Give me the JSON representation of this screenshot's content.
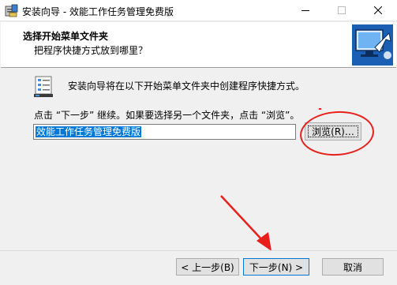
{
  "window": {
    "title": "安装向导 - 效能工作任务管理免费版"
  },
  "header": {
    "title": "选择开始菜单文件夹",
    "subtitle": "把程序快捷方式放到哪里？"
  },
  "body": {
    "description": "安装向导将在以下开始菜单文件夹中创建程序快捷方式。",
    "instruction": "点击 “下一步” 继续。如果要选择另一个文件夹，点击 “浏览”。",
    "folder_value": "效能工作任务管理免费版",
    "browse_label": "浏览(R)…"
  },
  "buttons": {
    "back": "< 上一步(B)",
    "next": "下一步(N) >",
    "cancel": "取消"
  },
  "colors": {
    "accent": "#0078d7",
    "annotation": "#e8201c"
  },
  "icons": [
    "setup-app-icon",
    "minimize-icon",
    "maximize-icon",
    "close-icon",
    "installer-logo-icon",
    "start-menu-folder-icon"
  ]
}
